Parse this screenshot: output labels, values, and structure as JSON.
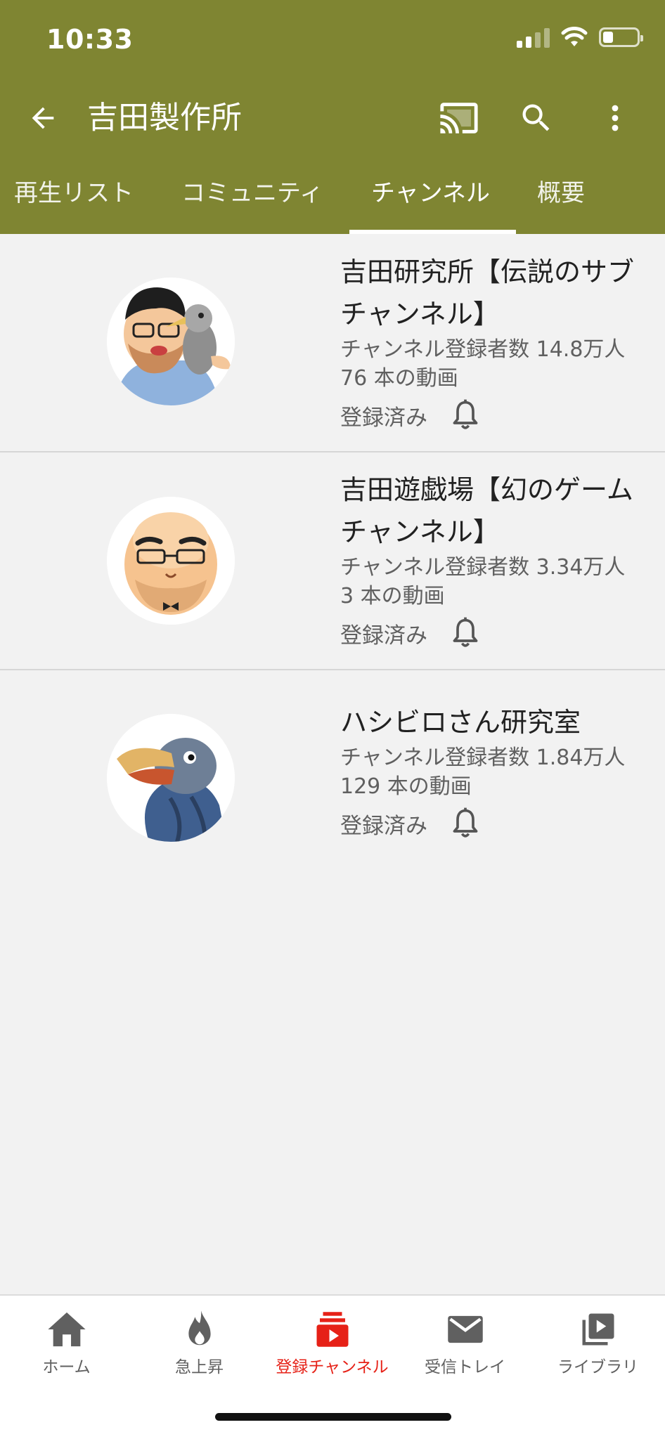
{
  "status_bar": {
    "time": "10:33",
    "battery_level": 0.3
  },
  "header": {
    "title": "吉田製作所",
    "icons": {
      "back": "arrow-left-icon",
      "cast": "cast-icon",
      "search": "search-icon",
      "more": "more-vert-icon"
    },
    "bg_color": "#7f8532"
  },
  "tabs": [
    {
      "label": "再生リスト",
      "active": false
    },
    {
      "label": "コミュニティ",
      "active": false
    },
    {
      "label": "チャンネル",
      "active": true
    },
    {
      "label": "概要",
      "active": false
    }
  ],
  "channels": [
    {
      "name": "吉田研究所【伝説のサブチャンネル】",
      "subscribers": "チャンネル登録者数 14.8万人",
      "videos": "76 本の動画",
      "status": "登録済み",
      "avatar": "bearded-man-with-bird-avatar"
    },
    {
      "name": "吉田遊戯場【幻のゲームチャンネル】",
      "subscribers": "チャンネル登録者数 3.34万人",
      "videos": "3 本の動画",
      "status": "登録済み",
      "avatar": "bald-man-with-glasses-avatar"
    },
    {
      "name": "ハシビロさん研究室",
      "subscribers": "チャンネル登録者数 1.84万人",
      "videos": "129 本の動画",
      "status": "登録済み",
      "avatar": "shoebill-bird-avatar"
    }
  ],
  "bottom_nav": [
    {
      "label": "ホーム",
      "icon": "home-icon",
      "active": false
    },
    {
      "label": "急上昇",
      "icon": "flame-icon",
      "active": false
    },
    {
      "label": "登録チャンネル",
      "icon": "subscriptions-icon",
      "active": true
    },
    {
      "label": "受信トレイ",
      "icon": "mail-icon",
      "active": false
    },
    {
      "label": "ライブラリ",
      "icon": "library-icon",
      "active": false
    }
  ],
  "colors": {
    "accent": "#e62117",
    "header": "#7f8532"
  }
}
